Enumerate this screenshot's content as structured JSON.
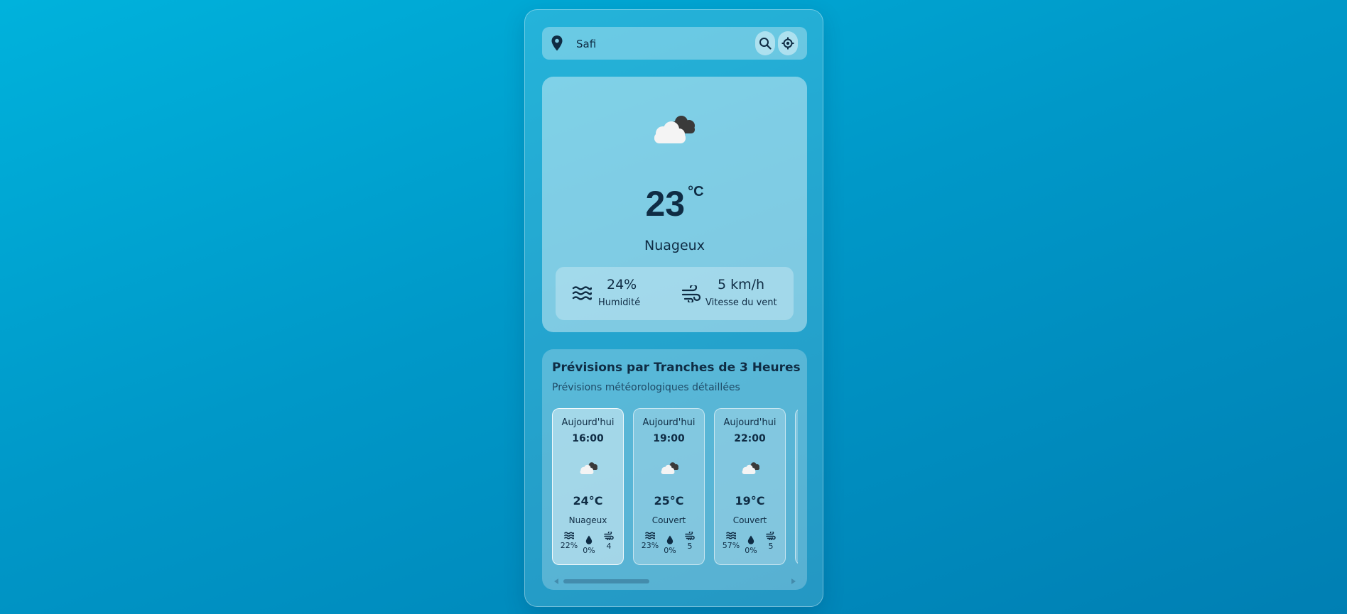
{
  "search": {
    "value": "Safi",
    "icons": {
      "location": "map-pin-icon",
      "search": "search-icon",
      "geolocate": "crosshair-icon"
    }
  },
  "current": {
    "icon": "broken-clouds-icon",
    "temperature": "23",
    "unit": "°C",
    "condition": "Nuageux",
    "humidity": {
      "value": "24%",
      "label": "Humidité",
      "icon": "humidity-waves-icon"
    },
    "wind": {
      "value": "5 km/h",
      "label": "Vitesse du vent",
      "icon": "wind-icon"
    }
  },
  "forecast": {
    "title": "Prévisions par Tranches de 3 Heures",
    "subtitle": "Prévisions météorologiques détaillées",
    "items": [
      {
        "day": "Aujourd'hui",
        "time": "16:00",
        "temp": "24°C",
        "desc": "Nuageux",
        "humidity": "22%",
        "precip": "0%",
        "wind": "4"
      },
      {
        "day": "Aujourd'hui",
        "time": "19:00",
        "temp": "25°C",
        "desc": "Couvert",
        "humidity": "23%",
        "precip": "0%",
        "wind": "5"
      },
      {
        "day": "Aujourd'hui",
        "time": "22:00",
        "temp": "19°C",
        "desc": "Couvert",
        "humidity": "57%",
        "precip": "0%",
        "wind": "5"
      }
    ]
  },
  "colors": {
    "text": "#0f2c44",
    "background_start": "#00b2dc",
    "background_end": "#007fb3",
    "cloud_light": "#f4f4f4",
    "cloud_dark": "#3a3a3a"
  }
}
